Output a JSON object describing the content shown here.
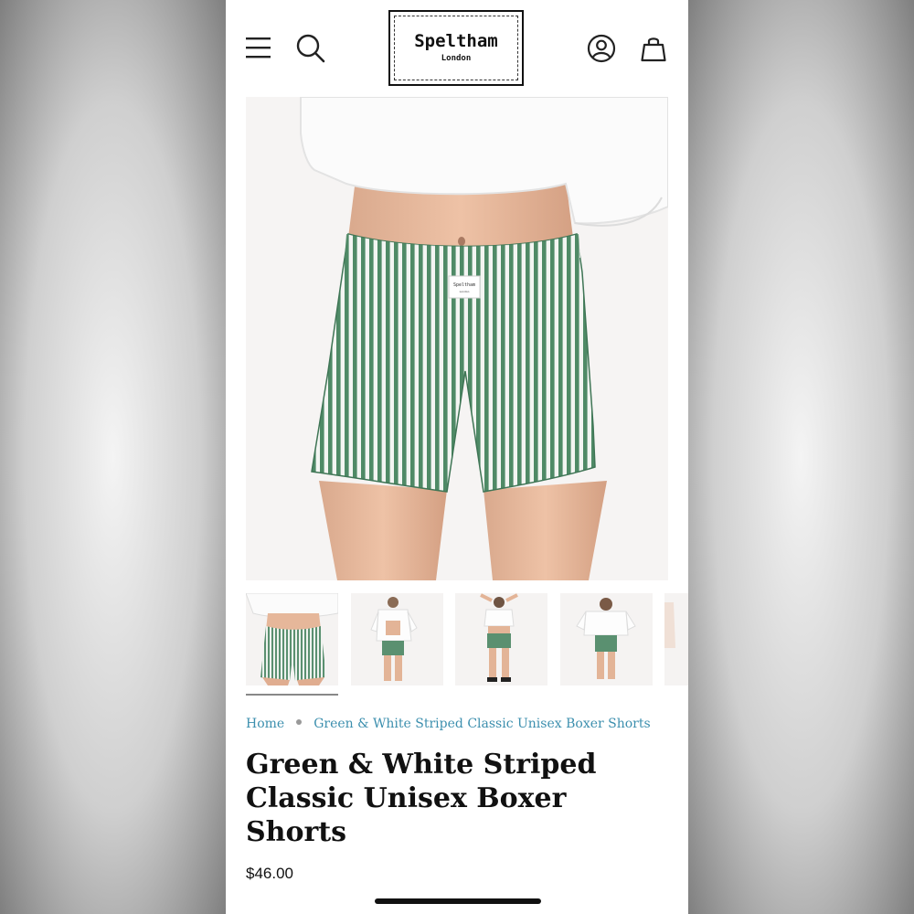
{
  "brand": {
    "name": "Speltham",
    "sub": "London",
    "label_name": "Speltham",
    "label_sub": "London"
  },
  "header": {
    "icons": [
      "menu-icon",
      "search-icon",
      "account-icon",
      "bag-icon"
    ]
  },
  "breadcrumb": {
    "home": "Home",
    "current": "Green & White Striped Classic Unisex Boxer Shorts"
  },
  "product": {
    "title": "Green & White Striped Classic Unisex Boxer Shorts",
    "price": "$46.00"
  },
  "gallery": {
    "thumbnails": [
      "front-closeup",
      "full-open-shirt",
      "full-arms-raised",
      "back-view",
      "partial"
    ]
  },
  "colors": {
    "link": "#3c8fae",
    "stripe_green": "#4f8a66",
    "text": "#111111"
  }
}
